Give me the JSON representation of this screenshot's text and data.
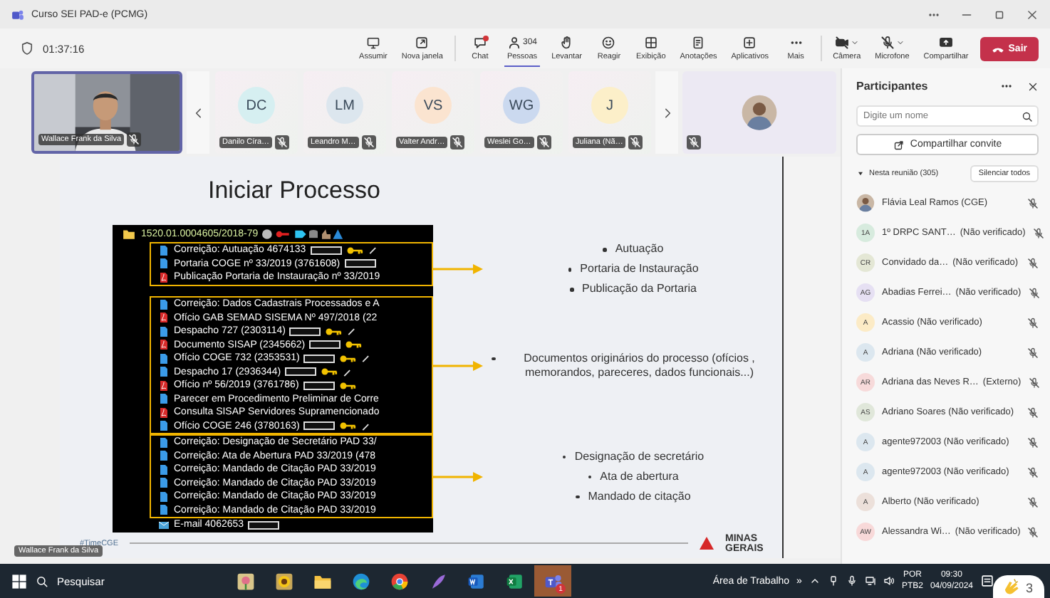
{
  "window": {
    "title": "Curso SEI PAD-e (PCMG)"
  },
  "meeting": {
    "timer": "01:37:16"
  },
  "toolbar": [
    {
      "label": "Assumir",
      "selected": false,
      "alert": false
    },
    {
      "label": "Nova janela",
      "selected": false,
      "alert": false
    },
    {
      "label": "Chat",
      "selected": false,
      "alert": true
    },
    {
      "label": "Pessoas",
      "count": "304",
      "selected": true,
      "alert": false
    },
    {
      "label": "Levantar",
      "selected": false,
      "alert": false
    },
    {
      "label": "Reagir",
      "selected": false,
      "alert": false
    },
    {
      "label": "Exibição",
      "selected": false,
      "alert": false
    },
    {
      "label": "Anotações",
      "selected": false,
      "alert": false
    },
    {
      "label": "Aplicativos",
      "selected": false,
      "alert": false
    },
    {
      "label": "Mais",
      "selected": false,
      "alert": false
    }
  ],
  "devices": [
    {
      "label": "Câmera",
      "on": false
    },
    {
      "label": "Microfone",
      "on": false
    },
    {
      "label": "Compartilhar",
      "on": true
    }
  ],
  "leave": {
    "label": "Sair"
  },
  "video_strip": {
    "presenter": {
      "name": "Wallace Frank da Silva",
      "muted": true
    },
    "tiles": [
      {
        "initials": "DC",
        "name": "Danilo Círa…",
        "color": "#d6eff1",
        "muted": true
      },
      {
        "initials": "LM",
        "name": "Leandro M…",
        "color": "#dce6ee",
        "muted": true
      },
      {
        "initials": "VS",
        "name": "Valter Andr…",
        "color": "#fbe4d0",
        "muted": true
      },
      {
        "initials": "WG",
        "name": "Weslei Go…",
        "color": "#cbd9ef",
        "muted": true
      },
      {
        "initials": "J",
        "name": "Juliana (Nã…",
        "color": "#fcefc9",
        "muted": true
      }
    ],
    "spotlight": {
      "muted": true
    }
  },
  "slide": {
    "title": "Iniciar Processo",
    "process": "1520.01.0004605/2018-79",
    "groups": [
      {
        "rows": [
          {
            "text": "Correição: Autuação 4674133",
            "kind": "doc",
            "tag": true,
            "key": true,
            "pen": true
          },
          {
            "text": "Portaria COGE nº 33/2019 (3761608)",
            "kind": "doc",
            "tag": true,
            "key": false,
            "pen": false
          },
          {
            "text": "Publicação Portaria de Instauração nº 33/2019",
            "kind": "pdf",
            "tag": false,
            "key": false,
            "pen": false
          }
        ],
        "bullets": [
          "Autuação",
          "Portaria de Instauração",
          "Publicação da Portaria"
        ]
      },
      {
        "rows": [
          {
            "text": "Correição: Dados Cadastrais Processados e A",
            "kind": "doc",
            "tag": false,
            "key": false,
            "pen": false
          },
          {
            "text": "Ofício GAB SEMAD SISEMA Nº 497/2018 (22",
            "kind": "pdf",
            "tag": false,
            "key": false,
            "pen": false
          },
          {
            "text": "Despacho 727 (2303114)",
            "kind": "doc",
            "tag": true,
            "key": true,
            "pen": true
          },
          {
            "text": "Documento SISAP (2345662)",
            "kind": "pdf",
            "tag": true,
            "key": true,
            "pen": false
          },
          {
            "text": "Ofício COGE 732 (2353531)",
            "kind": "doc",
            "tag": true,
            "key": true,
            "pen": true
          },
          {
            "text": "Despacho 17 (2936344)",
            "kind": "doc",
            "tag": true,
            "key": true,
            "pen": true
          },
          {
            "text": "Ofício nº 56/2019 (3761786)",
            "kind": "pdf",
            "tag": true,
            "key": true,
            "pen": false
          },
          {
            "text": "Parecer em Procedimento Preliminar de Corre",
            "kind": "doc",
            "tag": false,
            "key": false,
            "pen": false
          },
          {
            "text": "Consulta SISAP Servidores Supramencionado",
            "kind": "pdf",
            "tag": false,
            "key": false,
            "pen": false
          },
          {
            "text": "Ofício COGE 246 (3780163)",
            "kind": "doc",
            "tag": true,
            "key": true,
            "pen": true
          }
        ],
        "bullets": [
          "Documentos originários do processo (ofícios , memorandos, pareceres, dados funcionais...)"
        ]
      },
      {
        "rows": [
          {
            "text": "Correição: Designação de Secretário PAD 33/",
            "kind": "doc",
            "tag": false,
            "key": false,
            "pen": false
          },
          {
            "text": "Correição: Ata de Abertura PAD 33/2019 (478",
            "kind": "doc",
            "tag": false,
            "key": false,
            "pen": false
          },
          {
            "text": "Correição: Mandado de Citação PAD 33/2019",
            "kind": "doc",
            "tag": false,
            "key": false,
            "pen": false
          },
          {
            "text": "Correição: Mandado de Citação PAD 33/2019",
            "kind": "doc",
            "tag": false,
            "key": false,
            "pen": false
          },
          {
            "text": "Correição: Mandado de Citação PAD 33/2019",
            "kind": "doc",
            "tag": false,
            "key": false,
            "pen": false
          },
          {
            "text": "Correição: Mandado de Citação PAD 33/2019",
            "kind": "doc",
            "tag": false,
            "key": false,
            "pen": false
          }
        ],
        "bullets": [
          "Designação de secretário",
          "Ata de abertura",
          "Mandado de citação"
        ]
      }
    ],
    "after": [
      {
        "text": "E-mail 4062653",
        "kind": "mail",
        "tag": true,
        "key": false,
        "pen": false
      }
    ],
    "hashtag": "#TimeCGE",
    "logo": "MINAS GERAIS",
    "presenter_label": "Wallace Frank da Silva"
  },
  "panel": {
    "title": "Participantes",
    "search": {
      "placeholder": "Digite um nome"
    },
    "invite": "Compartilhar convite",
    "section": "Nesta reunião (305)",
    "expanded": true,
    "mute_all": "Silenciar todos",
    "people": [
      {
        "name": "Flávia Leal Ramos (CGE)",
        "muted": true
      },
      {
        "kind": "initials",
        "initials": "1A",
        "color": "#d7ebde",
        "name": "1º DRPC SANT…",
        "note": "(Não verificado)",
        "muted": true
      },
      {
        "kind": "initials",
        "initials": "CR",
        "color": "#e4e7d5",
        "name": "Convidado da…",
        "note": "(Não verificado)",
        "muted": true
      },
      {
        "kind": "initials",
        "initials": "AG",
        "color": "#e6e0f3",
        "name": "Abadias Ferrei…",
        "note": "(Não verificado)",
        "muted": true
      },
      {
        "kind": "initials",
        "initials": "A",
        "color": "#fcebc6",
        "name": "Acassio (Não verificado)",
        "muted": true
      },
      {
        "kind": "initials",
        "initials": "A",
        "color": "#dce7ef",
        "name": "Adriana (Não verificado)",
        "muted": true
      },
      {
        "kind": "initials",
        "initials": "AR",
        "color": "#f7dada",
        "name": "Adriana das Neves R…",
        "note": "(Externo)",
        "muted": true
      },
      {
        "kind": "initials",
        "initials": "AS",
        "color": "#e0e7da",
        "name": "Adriano Soares (Não verificado)",
        "muted": true
      },
      {
        "kind": "initials",
        "initials": "A",
        "color": "#dce7ef",
        "name": "agente972003 (Não verificado)",
        "muted": true
      },
      {
        "kind": "initials",
        "initials": "A",
        "color": "#dce7ef",
        "name": "agente972003 (Não verificado)",
        "muted": true
      },
      {
        "kind": "initials",
        "initials": "A",
        "color": "#ece0da",
        "name": "Alberto (Não verificado)",
        "muted": true
      },
      {
        "kind": "initials",
        "initials": "AW",
        "color": "#f8d9d9",
        "name": "Alessandra Wi…",
        "note": "(Não verificado)",
        "muted": true
      }
    ]
  },
  "taskbar": {
    "search": "Pesquisar",
    "apps": [
      {
        "selected": false
      },
      {
        "selected": false
      },
      {
        "selected": false
      },
      {
        "selected": false
      },
      {
        "selected": false
      },
      {
        "selected": false
      },
      {
        "selected": false
      },
      {
        "selected": false
      },
      {
        "selected": true,
        "badge": "1"
      }
    ],
    "desktop": "Área de Trabalho",
    "overflow": "»",
    "lang": "POR",
    "layout": "PTB2",
    "time": "09:30",
    "date": "04/09/2024"
  },
  "reaction": {
    "count": "3"
  }
}
